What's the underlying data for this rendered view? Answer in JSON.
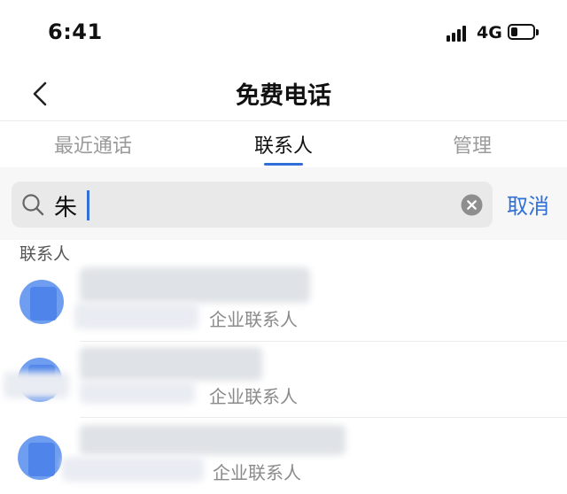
{
  "status_bar": {
    "time": "6:41",
    "network": "4G",
    "battery_level": 0.3
  },
  "nav": {
    "title": "免费电话",
    "back_icon": "chevron-left-icon"
  },
  "tabs": [
    {
      "label": "最近通话",
      "active": false
    },
    {
      "label": "联系人",
      "active": true
    },
    {
      "label": "管理",
      "active": false
    }
  ],
  "search": {
    "value": "朱",
    "cancel_label": "取消",
    "search_icon": "search-icon",
    "clear_icon": "clear-icon"
  },
  "results": {
    "section_label": "联系人",
    "items": [
      {
        "label": "企业联系人"
      },
      {
        "label": "企业联系人"
      },
      {
        "label": "企业联系人"
      }
    ]
  },
  "colors": {
    "accent": "#2f6fd6",
    "avatar": "#6f9df0"
  }
}
